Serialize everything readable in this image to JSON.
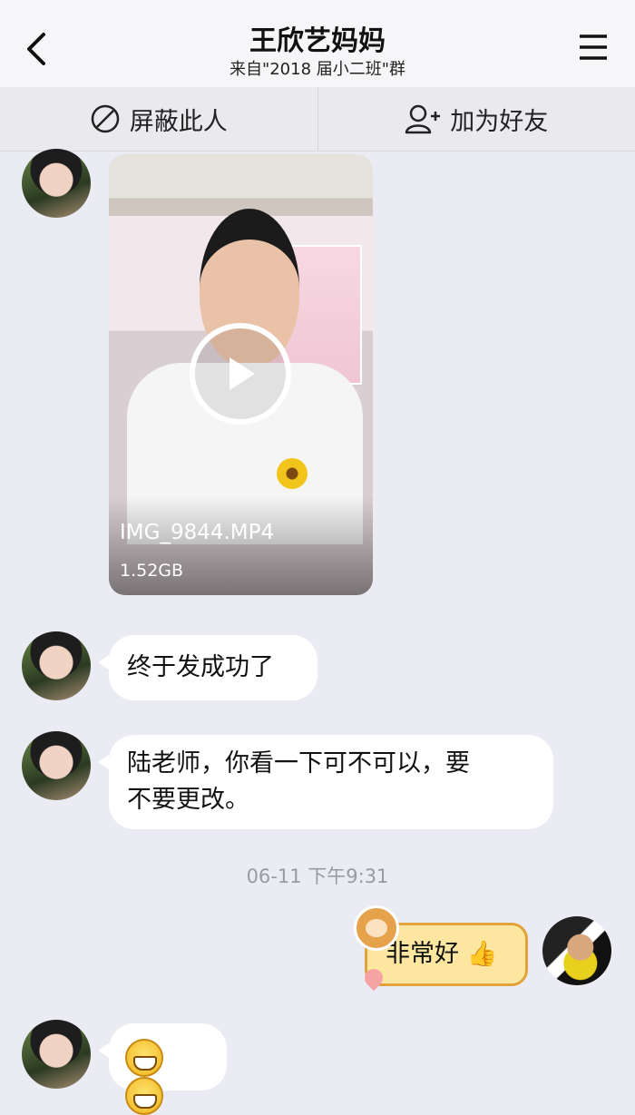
{
  "header": {
    "title": "王欣艺妈妈",
    "subtitle": "来自\"2018 届小二班\"群"
  },
  "actions": {
    "block_label": "屏蔽此人",
    "add_friend_label": "加为好友"
  },
  "messages": {
    "video": {
      "file_name": "IMG_9844.MP4",
      "file_size": "1.52GB"
    },
    "msg1": "终于发成功了",
    "msg2_line1": "陆老师，你看一下可不可以，要",
    "msg2_line2": "不要更改。",
    "timestamp": "06-11 下午9:31",
    "reply": "非常好",
    "reply_emoji": "👍"
  },
  "colors": {
    "background": "#ebebf3",
    "bubble": "#ffffff",
    "sticker_bubble": "#fde7a0",
    "sticker_border": "#e2a23a"
  }
}
